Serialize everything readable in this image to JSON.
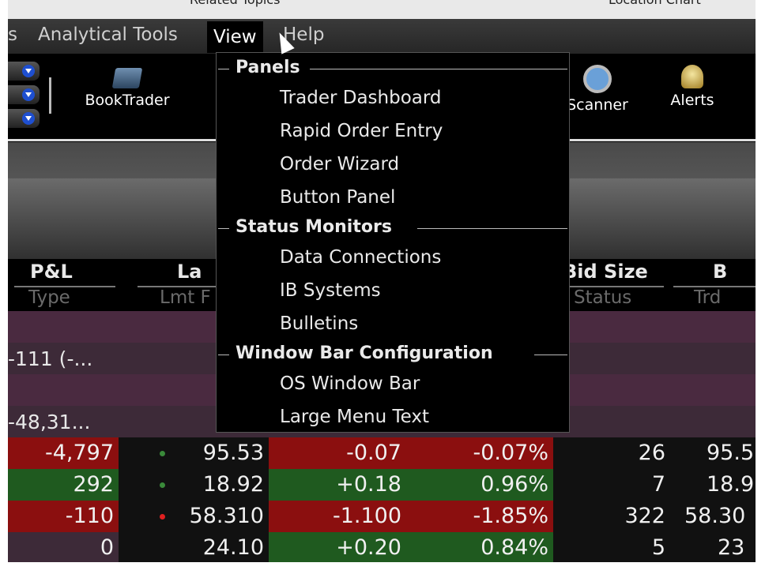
{
  "top_strip": {
    "left_text": "Related Topics",
    "right_text": "Location  Chart"
  },
  "menubar": {
    "items": [
      "s",
      "Analytical Tools",
      "View",
      "Help"
    ]
  },
  "toolbar": {
    "items": [
      {
        "label": "BookTrader",
        "icon": "book-icon"
      },
      {
        "label": "Scanner",
        "icon": "magnifier-icon"
      },
      {
        "label": "Alerts",
        "icon": "bell-icon"
      }
    ]
  },
  "table": {
    "headers": [
      {
        "top": "P&L",
        "sub": "Type"
      },
      {
        "top": "La",
        "sub": "Lmt F"
      },
      {
        "top": "Bid Size",
        "sub": "Status"
      },
      {
        "top": "B",
        "sub": "Trd"
      }
    ],
    "portfolio_rows": [
      "-111 (-...",
      "",
      "-48,31..."
    ],
    "rows": [
      {
        "pnl": "-4,797",
        "last": "95.53",
        "change": "-0.07",
        "pct": "-0.07%",
        "bidsize": "26",
        "bid": "95.5"
      },
      {
        "pnl": "292",
        "last": "18.92",
        "change": "+0.18",
        "pct": "0.96%",
        "bidsize": "7",
        "bid": "18.9"
      },
      {
        "pnl": "-110",
        "last": "58.310",
        "change": "-1.100",
        "pct": "-1.85%",
        "bidsize": "322",
        "bid": "58.30"
      },
      {
        "pnl": "0",
        "last": "24.10",
        "change": "+0.20",
        "pct": "0.84%",
        "bidsize": "5",
        "bid": "23"
      }
    ]
  },
  "view_menu": {
    "sections": [
      {
        "title": "Panels",
        "items": [
          "Trader Dashboard",
          "Rapid Order Entry",
          "Order Wizard",
          "Button Panel"
        ]
      },
      {
        "title": "Status Monitors",
        "items": [
          "Data Connections",
          "IB Systems",
          "Bulletins"
        ]
      },
      {
        "title": "Window Bar Configuration",
        "items": [
          "OS Window Bar",
          "Large Menu Text"
        ]
      }
    ]
  },
  "colors": {
    "negative_bg": "#8b0f0f",
    "positive_bg": "#1f5a1f",
    "accent_blue": "#1e4fd0"
  }
}
